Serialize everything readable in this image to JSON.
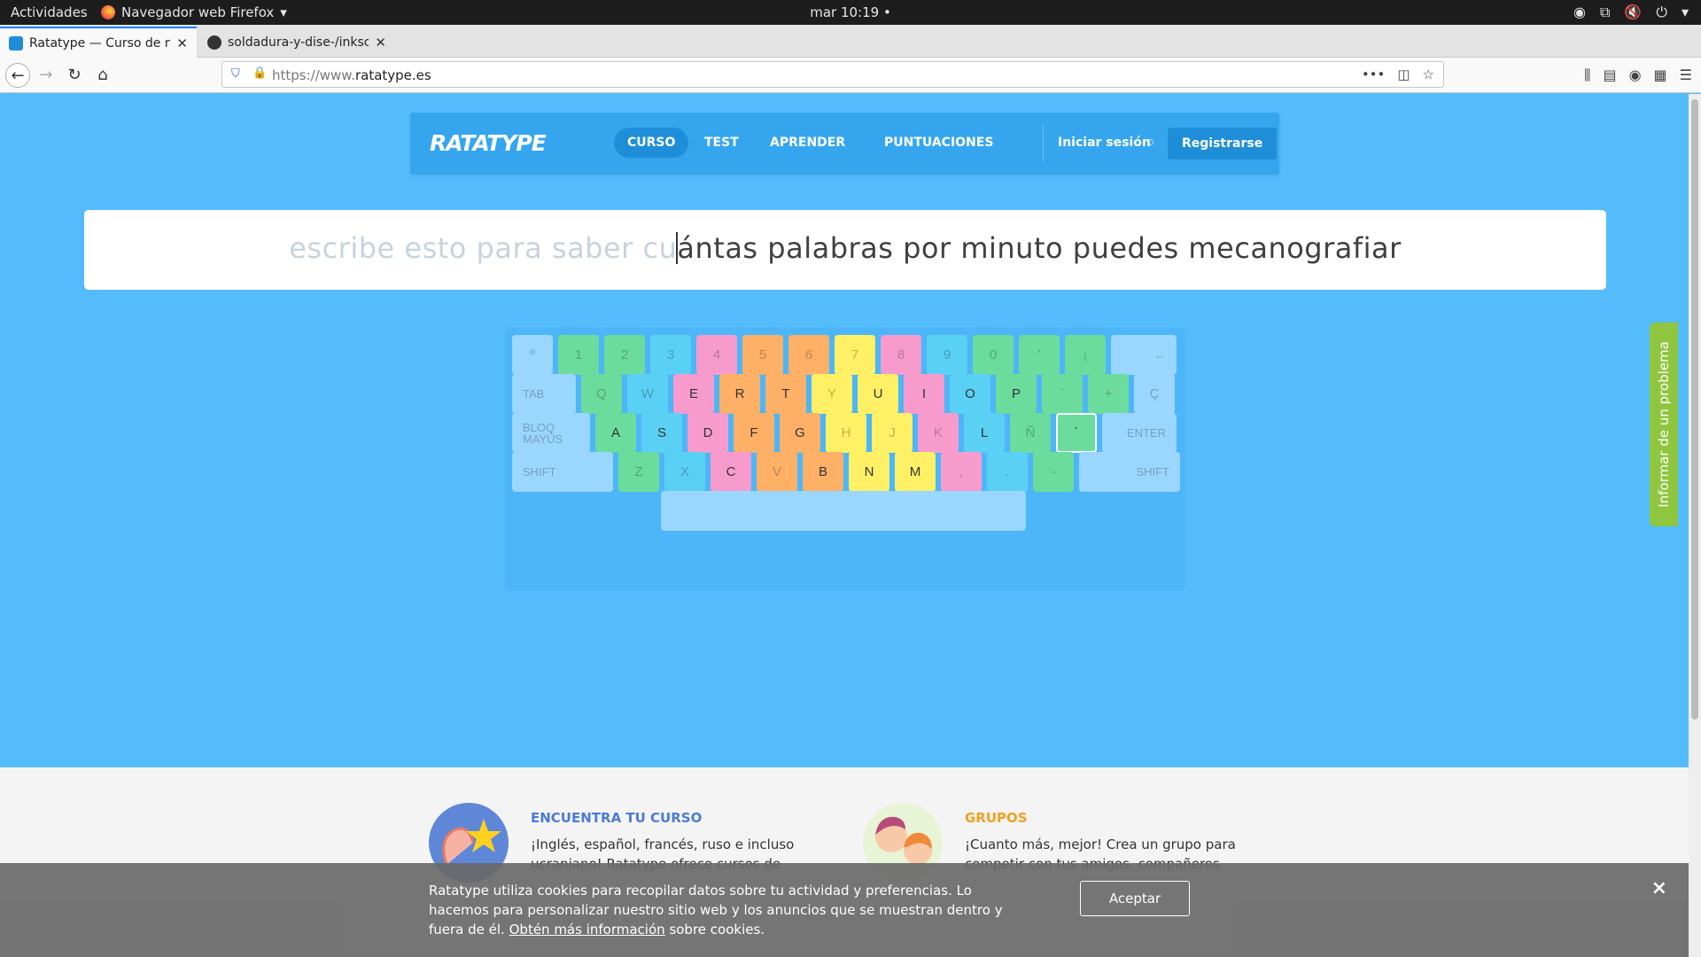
{
  "system": {
    "activities": "Actividades",
    "app_name": "Navegador web Firefox",
    "clock": "mar 10:19"
  },
  "browser": {
    "tabs": [
      {
        "title": "Ratatype — Curso de me",
        "active": true
      },
      {
        "title": "soldadura-y-dise-/inkscap",
        "active": false
      }
    ],
    "url_prefix": "https://www.",
    "url_host": "ratatype.es"
  },
  "site": {
    "logo": "RATATYPE",
    "nav": [
      {
        "label": "CURSO",
        "current": true
      },
      {
        "label": "TEST",
        "current": false
      },
      {
        "label": "APRENDER",
        "current": false
      },
      {
        "label": "PUNTUACIONES",
        "current": false
      }
    ],
    "login": "Iniciar sesión",
    "register": "Registrarse"
  },
  "typing": {
    "typed": "escribe esto para saber cu",
    "remaining": "ántas palabras por minuto puedes mecanografiar"
  },
  "keyboard": {
    "rows": [
      [
        {
          "label": "º",
          "color": "#9bd6ff",
          "dim": true
        },
        {
          "label": "1",
          "color": "#6cdc9c",
          "dim": true
        },
        {
          "label": "2",
          "color": "#6cdc9c",
          "dim": true
        },
        {
          "label": "3",
          "color": "#5bd0f5",
          "dim": true
        },
        {
          "label": "4",
          "color": "#f79bcd",
          "dim": true
        },
        {
          "label": "5",
          "color": "#ffb067",
          "dim": true
        },
        {
          "label": "6",
          "color": "#ffb067",
          "dim": true
        },
        {
          "label": "7",
          "color": "#fff065",
          "dim": true
        },
        {
          "label": "8",
          "color": "#f79bcd",
          "dim": true
        },
        {
          "label": "9",
          "color": "#5bd0f5",
          "dim": true
        },
        {
          "label": "0",
          "color": "#6cdc9c",
          "dim": true
        },
        {
          "label": "'",
          "color": "#6cdc9c",
          "dim": true
        },
        {
          "label": "¡",
          "color": "#6cdc9c",
          "dim": true
        },
        {
          "label": "←",
          "color": "#9bd6ff",
          "dim": true
        }
      ],
      [
        {
          "label": "TAB",
          "color": "#9bd6ff",
          "dim": true
        },
        {
          "label": "Q",
          "color": "#6cdc9c",
          "dim": true
        },
        {
          "label": "W",
          "color": "#5bd0f5",
          "dim": true
        },
        {
          "label": "E",
          "color": "#f79bcd",
          "dim": false
        },
        {
          "label": "R",
          "color": "#ffb067",
          "dim": false
        },
        {
          "label": "T",
          "color": "#ffb067",
          "dim": false
        },
        {
          "label": "Y",
          "color": "#fff065",
          "dim": true
        },
        {
          "label": "U",
          "color": "#fff065",
          "dim": false
        },
        {
          "label": "I",
          "color": "#f79bcd",
          "dim": false
        },
        {
          "label": "O",
          "color": "#5bd0f5",
          "dim": false
        },
        {
          "label": "P",
          "color": "#6cdc9c",
          "dim": false
        },
        {
          "label": "`",
          "color": "#6cdc9c",
          "dim": true
        },
        {
          "label": "+",
          "color": "#6cdc9c",
          "dim": true
        },
        {
          "label": "Ç",
          "color": "#9bd6ff",
          "dim": true
        }
      ],
      [
        {
          "label": "BLOQ MAYÚS",
          "color": "#9bd6ff",
          "dim": true
        },
        {
          "label": "A",
          "color": "#6cdc9c",
          "dim": false
        },
        {
          "label": "S",
          "color": "#5bd0f5",
          "dim": false
        },
        {
          "label": "D",
          "color": "#f79bcd",
          "dim": false
        },
        {
          "label": "F",
          "color": "#ffb067",
          "dim": false
        },
        {
          "label": "G",
          "color": "#ffb067",
          "dim": false
        },
        {
          "label": "H",
          "color": "#fff065",
          "dim": true
        },
        {
          "label": "J",
          "color": "#fff065",
          "dim": true
        },
        {
          "label": "K",
          "color": "#f79bcd",
          "dim": true
        },
        {
          "label": "L",
          "color": "#5bd0f5",
          "dim": false
        },
        {
          "label": "Ñ",
          "color": "#6cdc9c",
          "dim": true
        },
        {
          "label": "´",
          "color": "#6cdc9c",
          "dim": false
        },
        {
          "label": "ENTER",
          "color": "#9bd6ff",
          "dim": true
        }
      ],
      [
        {
          "label": "SHIFT",
          "color": "#9bd6ff",
          "dim": true
        },
        {
          "label": "Z",
          "color": "#6cdc9c",
          "dim": true
        },
        {
          "label": "X",
          "color": "#5bd0f5",
          "dim": true
        },
        {
          "label": "C",
          "color": "#f79bcd",
          "dim": false
        },
        {
          "label": "V",
          "color": "#ffb067",
          "dim": true
        },
        {
          "label": "B",
          "color": "#ffb067",
          "dim": false
        },
        {
          "label": "N",
          "color": "#fff065",
          "dim": false
        },
        {
          "label": "M",
          "color": "#fff065",
          "dim": false
        },
        {
          "label": ",",
          "color": "#f79bcd",
          "dim": true
        },
        {
          "label": ".",
          "color": "#5bd0f5",
          "dim": true
        },
        {
          "label": "-",
          "color": "#6cdc9c",
          "dim": true
        },
        {
          "label": "SHIFT",
          "color": "#9bd6ff",
          "dim": true
        }
      ],
      [
        {
          "label": "",
          "color": "#9bd6ff",
          "dim": true
        }
      ]
    ],
    "target_key": "´"
  },
  "features": [
    {
      "title": "ENCUENTRA TU CURSO",
      "title_color": "#4b7bd6",
      "text_line1": "¡Inglés, español, francés, ruso e incluso",
      "text_line2": "ucraniano! Ratatype ofrece cursos de"
    },
    {
      "title": "GRUPOS",
      "title_color": "#f0a020",
      "text_line1": "¡Cuanto más, mejor! Crea un grupo para",
      "text_line2": "competir con tus amigos, compañeros"
    }
  ],
  "feedback": "Informar de un problema",
  "cookie": {
    "text_main": "Ratatype utiliza cookies para recopilar datos sobre tu actividad y preferencias. Lo hacemos para personalizar nuestro sitio web y los anuncios que se muestran dentro y fuera de él.",
    "link": "Obtén más información",
    "text_after": "sobre cookies.",
    "accept": "Aceptar",
    "close": "×"
  }
}
